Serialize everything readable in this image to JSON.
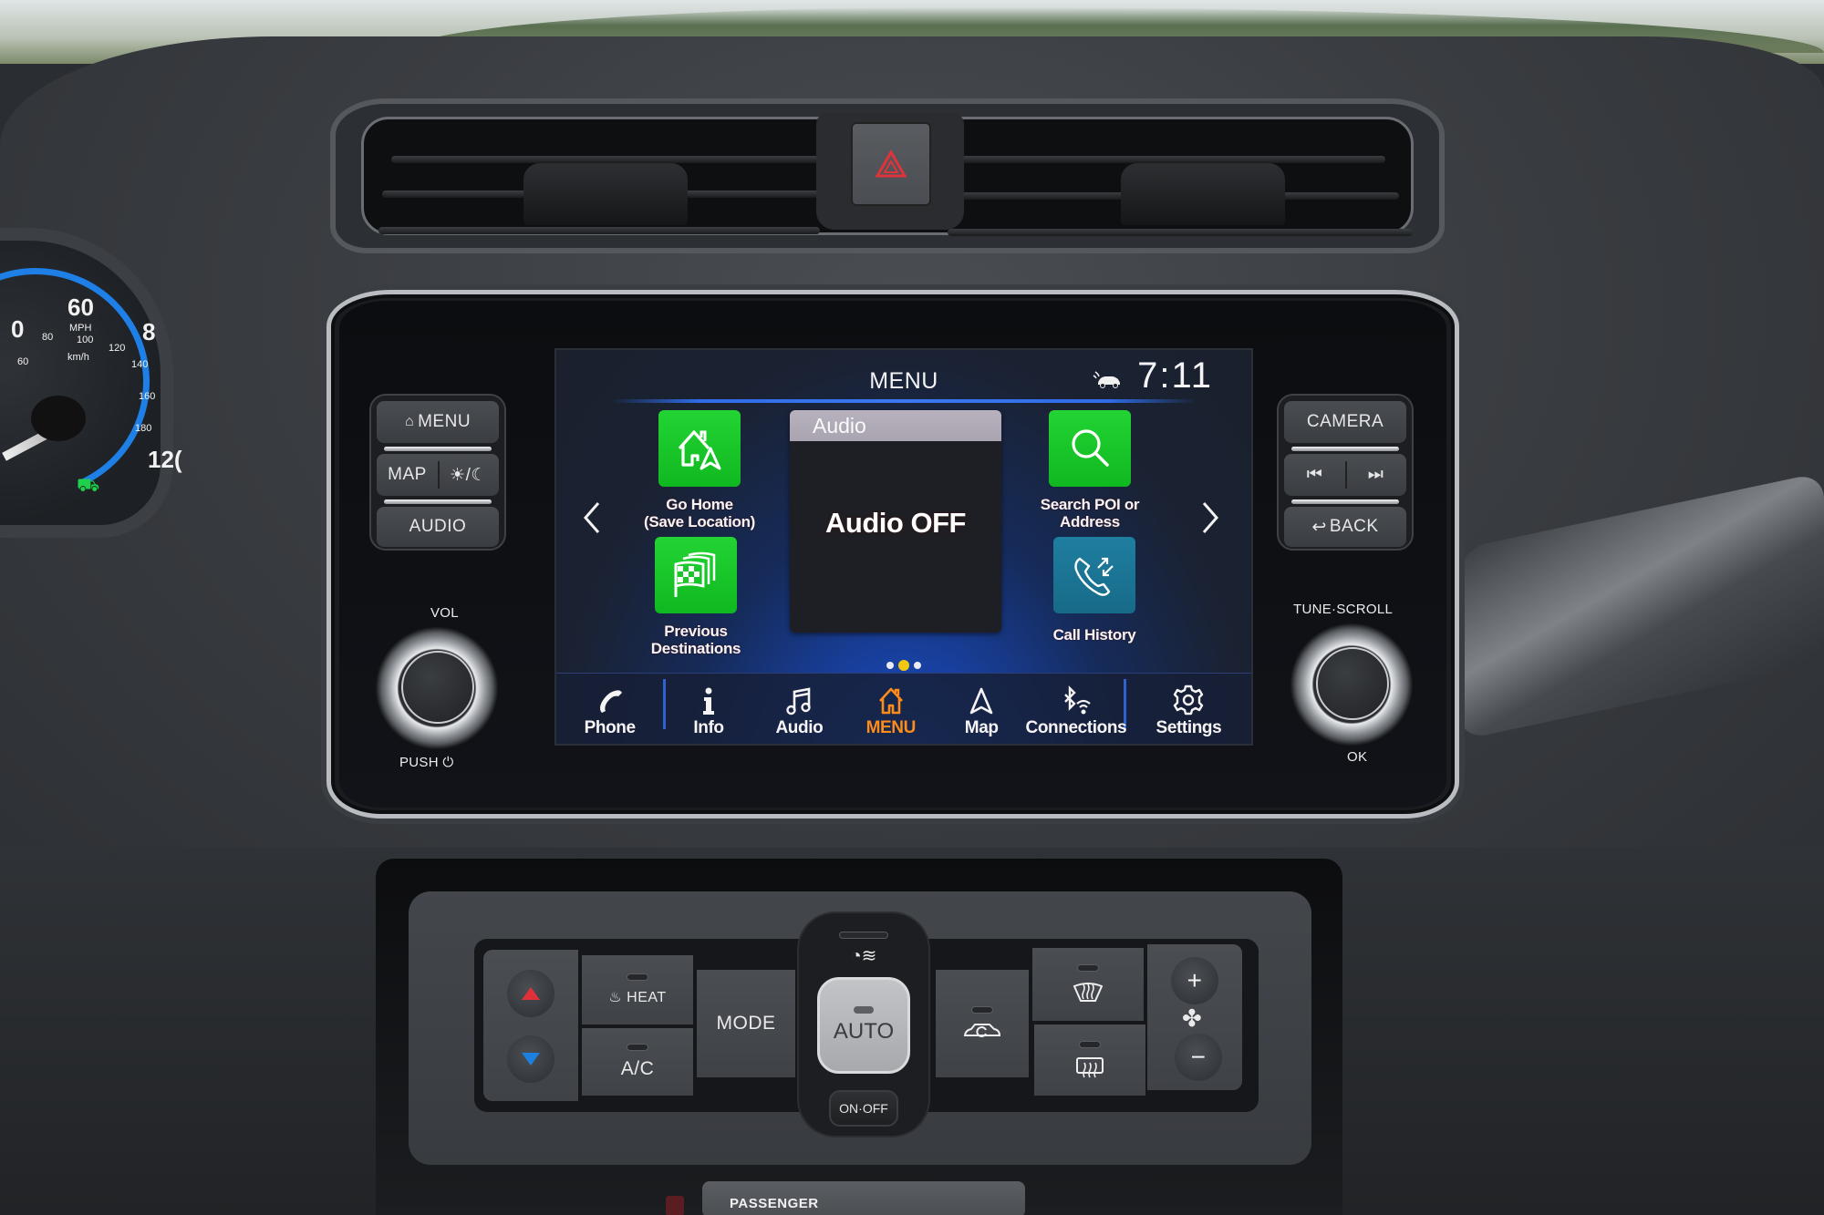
{
  "screen": {
    "title": "MENU",
    "clock": "7:11",
    "status_icon": "connected-car-icon",
    "accent_color": "#2f6ce8",
    "active_color": "#ff8c1a",
    "nav": {
      "prev": "chevron-left-icon",
      "next": "chevron-right-icon"
    },
    "tiles": [
      {
        "id": "go-home",
        "label_line1": "Go Home",
        "label_line2": "(Save Location)",
        "icon": "home-navigate-icon",
        "color": "#10c820"
      },
      {
        "id": "previous-destinations",
        "label_line1": "Previous",
        "label_line2": "Destinations",
        "icon": "checkered-flags-icon",
        "color": "#10c820"
      },
      {
        "id": "search-poi",
        "label_line1": "Search POI or",
        "label_line2": "Address",
        "icon": "search-icon",
        "color": "#10c820"
      },
      {
        "id": "call-history",
        "label_line1": "Call History",
        "label_line2": "",
        "icon": "phone-incoming-outgoing-icon",
        "color": "#1a7596"
      }
    ],
    "audio_widget": {
      "header": "Audio",
      "status": "Audio OFF"
    },
    "page_indicator": {
      "total": 3,
      "current": 2
    },
    "bottom_bar": [
      {
        "label": "Phone",
        "icon": "phone-handset-icon",
        "active": false
      },
      {
        "label": "Info",
        "icon": "info-icon",
        "active": false
      },
      {
        "label": "Audio",
        "icon": "music-note-icon",
        "active": false
      },
      {
        "label": "MENU",
        "icon": "home-icon",
        "active": true
      },
      {
        "label": "Map",
        "icon": "navigation-arrow-icon",
        "active": false
      },
      {
        "label": "Connections",
        "icon": "bluetooth-wifi-icon",
        "active": false
      },
      {
        "label": "Settings",
        "icon": "gear-icon",
        "active": false
      }
    ]
  },
  "hardware_left": {
    "menu": "MENU",
    "map": "MAP",
    "day_night": "☀/☾",
    "audio": "AUDIO",
    "vol_label": "VOL",
    "push_label": "PUSH"
  },
  "hardware_right": {
    "camera": "CAMERA",
    "prev_track": "⏮",
    "next_track": "⏭",
    "back": "BACK",
    "tune_label": "TUNE·SCROLL",
    "ok_label": "OK"
  },
  "climate": {
    "heat": "HEAT",
    "ac": "A/C",
    "mode": "MODE",
    "auto": "AUTO",
    "on_off": "ON·OFF",
    "temp_up_color": "#e0303a",
    "temp_down_color": "#1d7fe0",
    "fan_plus": "+",
    "fan_minus": "−"
  },
  "passenger_label": "PASSENGER",
  "cluster": {
    "mph_60": "60",
    "mph_unit": "MPH",
    "kmh_unit": "km/h",
    "kmh_ticks": [
      "60",
      "80",
      "100",
      "120",
      "140",
      "160",
      "180"
    ],
    "mph_partial_left": "0",
    "mph_partial_right": "8",
    "mph_partial_bottom": "12("
  }
}
